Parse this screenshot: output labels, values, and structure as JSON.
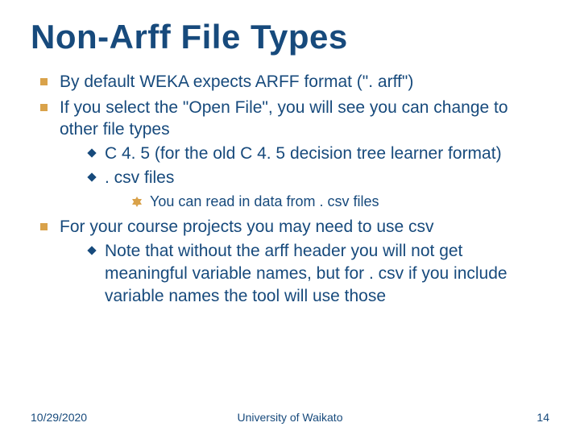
{
  "title": "Non-Arff File Types",
  "bullets": {
    "b1": "By default WEKA expects ARFF format (\". arff\")",
    "b2": "If you select the \"Open File\", you will see you can change to other file types",
    "b2_sub": {
      "s1": "C 4. 5 (for the old C 4. 5 decision tree learner format)",
      "s2": ". csv files",
      "s2_sub": {
        "t1": "You can read in data from . csv files"
      }
    },
    "b3": "For your course projects you may need to use csv",
    "b3_sub": {
      "s1": "Note that without the arff header you will not get meaningful variable names, but for . csv if you include variable names the tool will use those"
    }
  },
  "footer": {
    "date": "10/29/2020",
    "org": "University of Waikato",
    "page": "14"
  }
}
